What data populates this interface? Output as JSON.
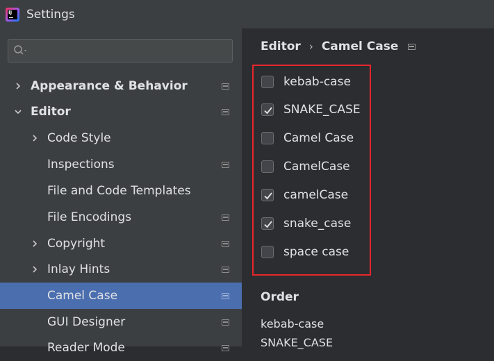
{
  "window": {
    "title": "Settings"
  },
  "search": {
    "placeholder": ""
  },
  "sidebar": {
    "items": [
      {
        "label": "Appearance & Behavior",
        "name": "sidebar-item-appearance-behavior"
      },
      {
        "label": "Editor",
        "name": "sidebar-item-editor"
      },
      {
        "label": "Code Style",
        "name": "sidebar-item-code-style"
      },
      {
        "label": "Inspections",
        "name": "sidebar-item-inspections"
      },
      {
        "label": "File and Code Templates",
        "name": "sidebar-item-file-and-code-templates"
      },
      {
        "label": "File Encodings",
        "name": "sidebar-item-file-encodings"
      },
      {
        "label": "Copyright",
        "name": "sidebar-item-copyright"
      },
      {
        "label": "Inlay Hints",
        "name": "sidebar-item-inlay-hints"
      },
      {
        "label": "Camel Case",
        "name": "sidebar-item-camel-case"
      },
      {
        "label": "GUI Designer",
        "name": "sidebar-item-gui-designer"
      },
      {
        "label": "Reader Mode",
        "name": "sidebar-item-reader-mode"
      }
    ]
  },
  "breadcrumb": {
    "parent": "Editor",
    "separator": "›",
    "current": "Camel Case"
  },
  "options": [
    {
      "label": "kebab-case",
      "checked": false
    },
    {
      "label": "SNAKE_CASE",
      "checked": true
    },
    {
      "label": "Camel Case",
      "checked": false
    },
    {
      "label": "CamelCase",
      "checked": false
    },
    {
      "label": "camelCase",
      "checked": true
    },
    {
      "label": "snake_case",
      "checked": true
    },
    {
      "label": "space case",
      "checked": false
    }
  ],
  "order": {
    "title": "Order",
    "items": [
      "kebab-case",
      "SNAKE_CASE"
    ]
  },
  "colors": {
    "selection": "#4b6eaf",
    "highlight_border": "#e8262b",
    "sidebar_bg": "#3c3f41",
    "content_bg": "#2b2d30"
  }
}
